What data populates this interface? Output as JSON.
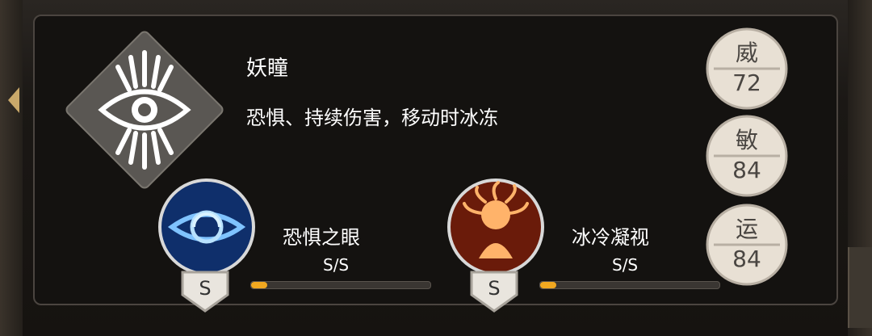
{
  "skill": {
    "name": "妖瞳",
    "description": "恐惧、持续伤害，移动时冰冻",
    "emblem_icon": "eye-emblem-icon"
  },
  "stats": [
    {
      "label": "威",
      "value": "72"
    },
    {
      "label": "敏",
      "value": "84"
    },
    {
      "label": "运",
      "value": "84"
    }
  ],
  "sub_skills": [
    {
      "name": "恐惧之眼",
      "progress_text": "S/S",
      "grade": "S",
      "icon": "blue-eye-icon",
      "progress_fraction": 0.09
    },
    {
      "name": "冰冷凝视",
      "progress_text": "S/S",
      "grade": "S",
      "icon": "medusa-icon",
      "progress_fraction": 0.09
    }
  ],
  "colors": {
    "accent": "#f1a820",
    "panel_border": "#4b4540",
    "stat_badge": "#e8e0d4"
  }
}
